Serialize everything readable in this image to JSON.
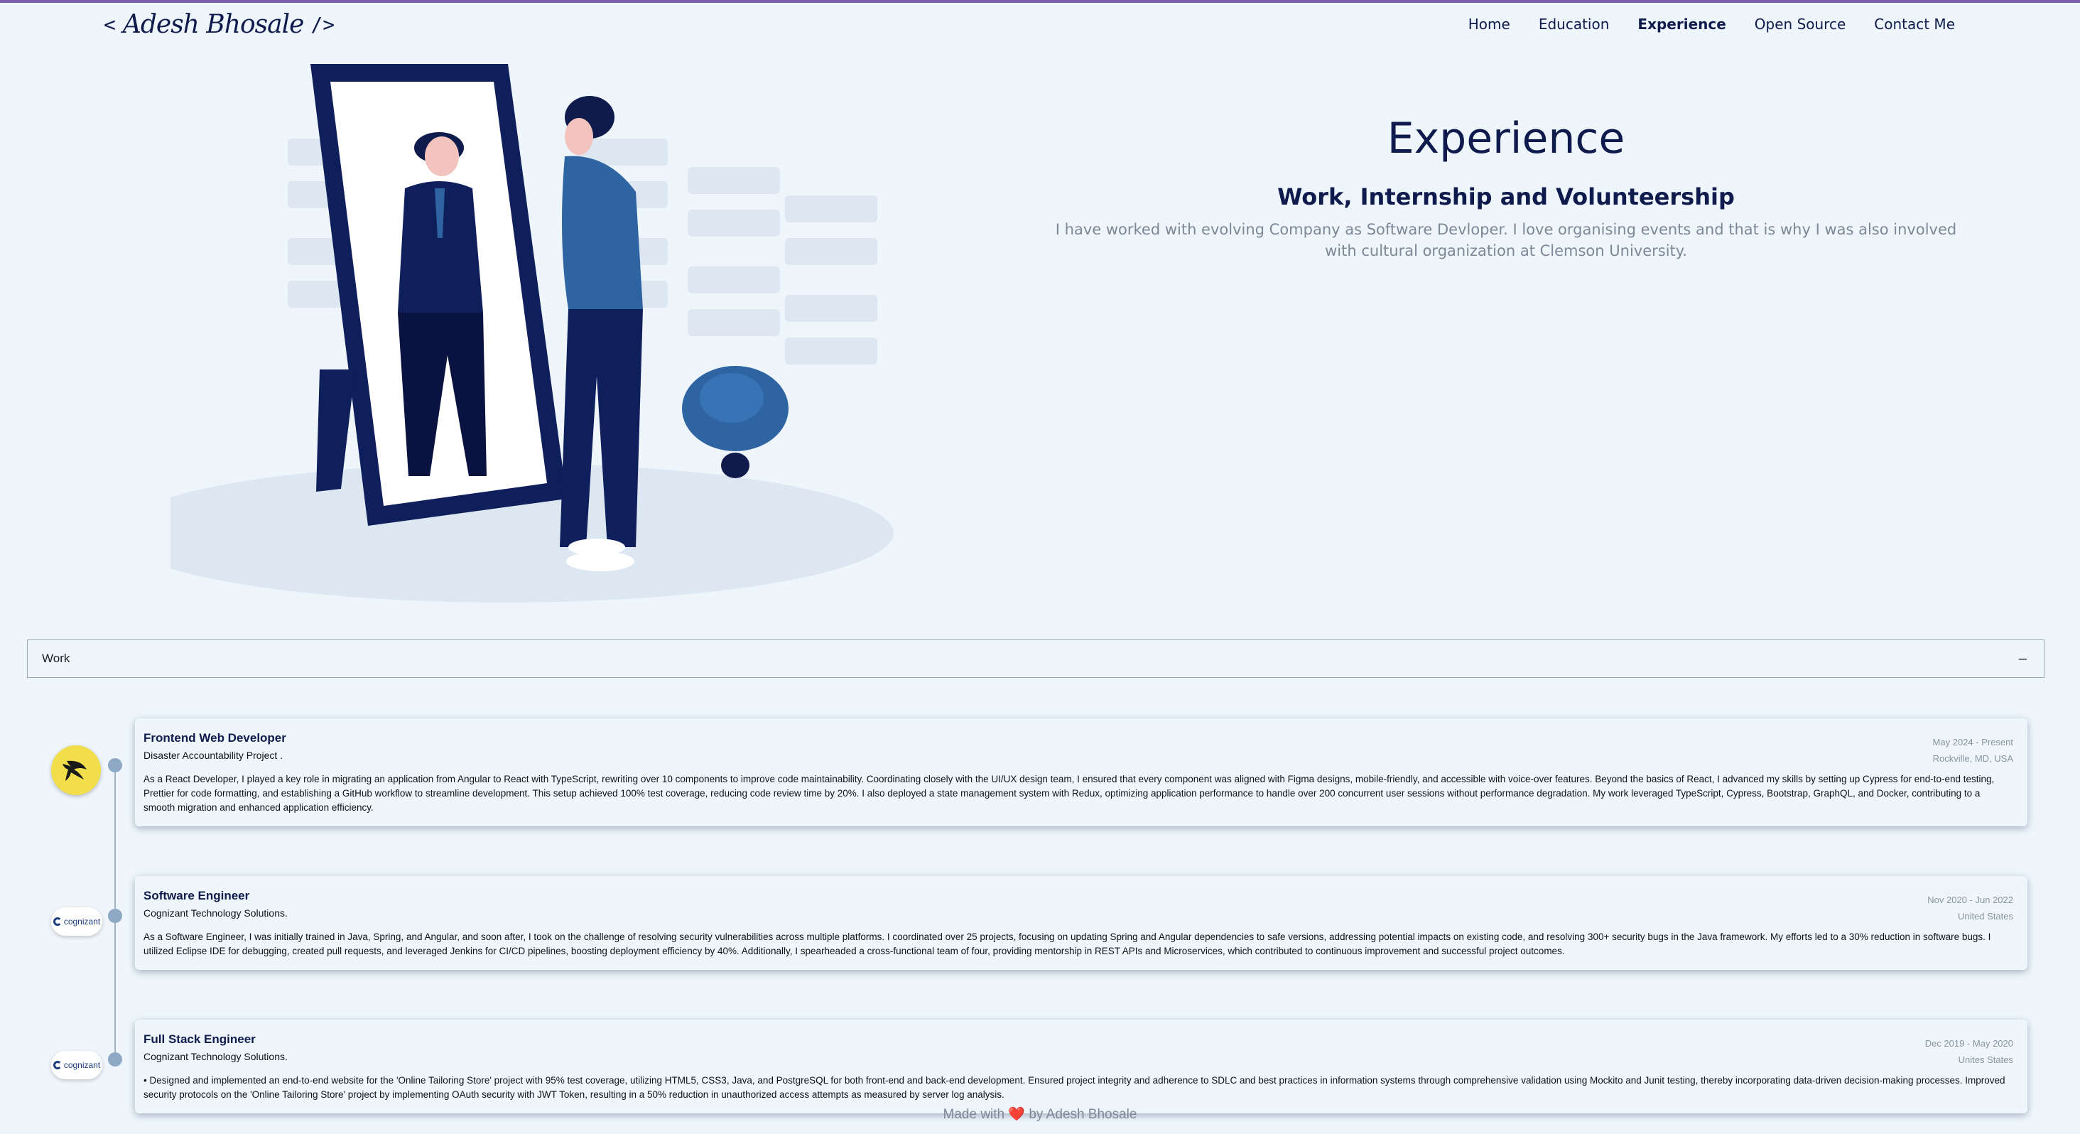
{
  "header": {
    "logo_open": "<",
    "logo_name": "Adesh Bhosale",
    "logo_close": "/>",
    "nav": [
      "Home",
      "Education",
      "Experience",
      "Open Source",
      "Contact Me"
    ],
    "active_nav": "Experience"
  },
  "hero": {
    "title": "Experience",
    "subtitle": "Work, Internship and Volunteership",
    "description": "I have worked with evolving Company as Software Devloper. I love organising events and that is why I was also involved with cultural organization at Clemson University."
  },
  "accordion": {
    "label": "Work",
    "toggle": "–"
  },
  "experiences": [
    {
      "title": "Frontend Web Developer",
      "company": "Disaster Accountability Project .",
      "date": "May 2024 - Present",
      "location": "Rockville, MD, USA",
      "logo": "palm-logo",
      "description": "As a React Developer, I played a key role in migrating an application from Angular to React with TypeScript, rewriting over 10 components to improve code maintainability. Coordinating closely with the UI/UX design team, I ensured that every component was aligned with Figma designs, mobile-friendly, and accessible with voice-over features. Beyond the basics of React, I advanced my skills by setting up Cypress for end-to-end testing, Prettier for code formatting, and establishing a GitHub workflow to streamline development. This setup achieved 100% test coverage, reducing code review time by 20%. I also deployed a state management system with Redux, optimizing application performance to handle over 200 concurrent user sessions without performance degradation. My work leveraged TypeScript, Cypress, Bootstrap, GraphQL, and Docker, contributing to a smooth migration and enhanced application efficiency."
    },
    {
      "title": "Software Engineer",
      "company": "Cognizant Technology Solutions.",
      "date": "Nov 2020 - Jun 2022",
      "location": "United States",
      "logo": "cognizant",
      "description": "As a Software Engineer, I was initially trained in Java, Spring, and Angular, and soon after, I took on the challenge of resolving security vulnerabilities across multiple platforms. I coordinated over 25 projects, focusing on updating Spring and Angular dependencies to safe versions, addressing potential impacts on existing code, and resolving 300+ security bugs in the Java framework. My efforts led to a 30% reduction in software bugs. I utilized Eclipse IDE for debugging, created pull requests, and leveraged Jenkins for CI/CD pipelines, boosting deployment efficiency by 40%. Additionally, I spearheaded a cross-functional team of four, providing mentorship in REST APIs and Microservices, which contributed to continuous improvement and successful project outcomes."
    },
    {
      "title": "Full Stack Engineer",
      "company": "Cognizant Technology Solutions.",
      "date": "Dec 2019 - May 2020",
      "location": "Unites States",
      "logo": "cognizant",
      "description": "• Designed and implemented an end-to-end website for the 'Online Tailoring Store' project with 95% test coverage, utilizing HTML5, CSS3, Java, and PostgreSQL for both front-end and back-end development. Ensured project integrity and adherence to SDLC and best practices in information systems through comprehensive validation using Mockito and Junit testing, thereby incorporating data-driven decision-making processes. Improved security protocols on the 'Online Tailoring Store' project by implementing OAuth security with JWT Token, resulting in a 50% reduction in unauthorized access attempts as measured by server log analysis."
    }
  ],
  "footer": {
    "prefix": "Made with",
    "heart": "❤️",
    "suffix": "by Adesh Bhosale"
  },
  "colors": {
    "primary": "#0f1b4c",
    "accent": "#2f64a3",
    "background": "#eef6fc",
    "muted": "#7d8796"
  }
}
